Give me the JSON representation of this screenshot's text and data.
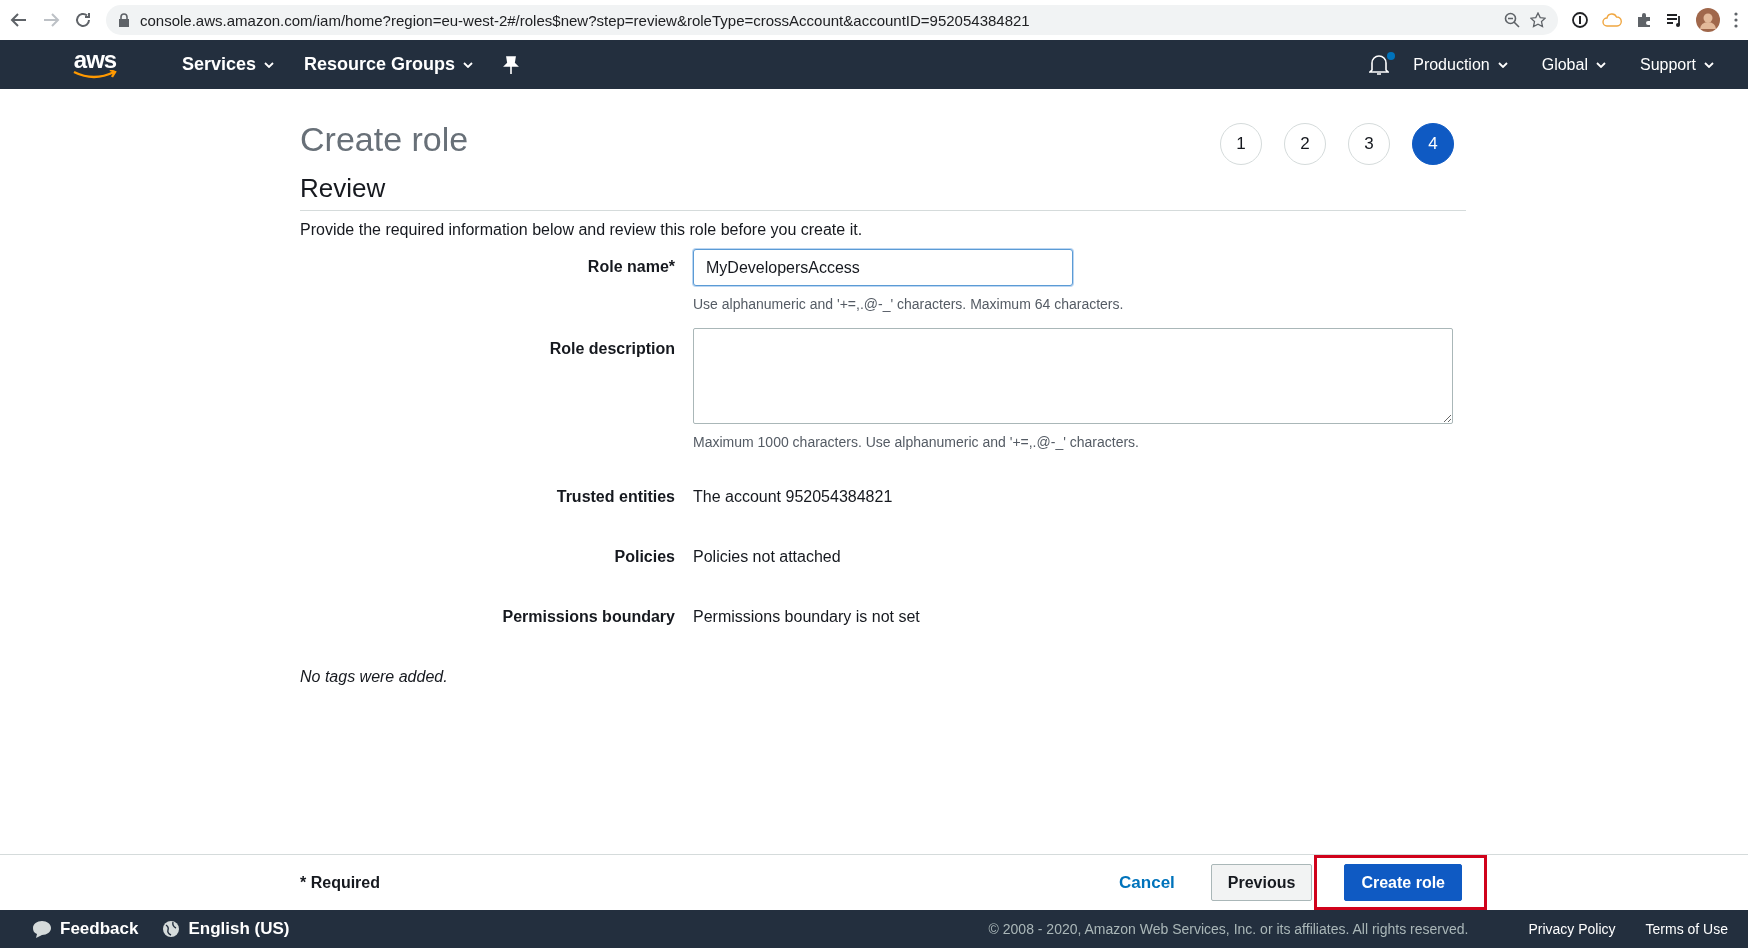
{
  "browser": {
    "url": "console.aws.amazon.com/iam/home?region=eu-west-2#/roles$new?step=review&roleType=crossAccount&accountID=952054384821"
  },
  "nav": {
    "logo": "aws",
    "menus": [
      {
        "label": "Services"
      },
      {
        "label": "Resource Groups"
      }
    ],
    "notification_dot": true,
    "right_menus": [
      {
        "label": "Production"
      },
      {
        "label": "Global"
      },
      {
        "label": "Support"
      }
    ]
  },
  "page": {
    "title": "Create role",
    "steps": [
      {
        "label": "1",
        "selected": false
      },
      {
        "label": "2",
        "selected": false
      },
      {
        "label": "3",
        "selected": false
      },
      {
        "label": "4",
        "selected": true
      }
    ],
    "section": "Review",
    "intro": "Provide the required information below and review this role before you create it.",
    "fields": [
      {
        "kind": "input",
        "label": "Role name*",
        "value": "MyDevelopersAccess",
        "hint": "Use alphanumeric and '+=,.@-_' characters. Maximum 64 characters."
      },
      {
        "kind": "textarea",
        "label": "Role description",
        "hint": "Maximum 1000 characters. Use alphanumeric and '+=,.@-_' characters."
      },
      {
        "kind": "text",
        "label": "Trusted entities",
        "value": "The account 952054384821"
      },
      {
        "kind": "text",
        "label": "Policies",
        "value": "Policies not attached"
      },
      {
        "kind": "text",
        "label": "Permissions boundary",
        "value": "Permissions boundary is not set"
      }
    ],
    "tags_note": "No tags were added."
  },
  "actions": {
    "required": "* Required",
    "cancel": "Cancel",
    "previous": "Previous",
    "create": "Create role",
    "create_highlighted": true
  },
  "footer": {
    "feedback": "Feedback",
    "language": "English (US)",
    "copyright": "© 2008 - 2020, Amazon Web Services, Inc. or its affiliates. All rights reserved.",
    "links": [
      "Privacy Policy",
      "Terms of Use"
    ]
  }
}
